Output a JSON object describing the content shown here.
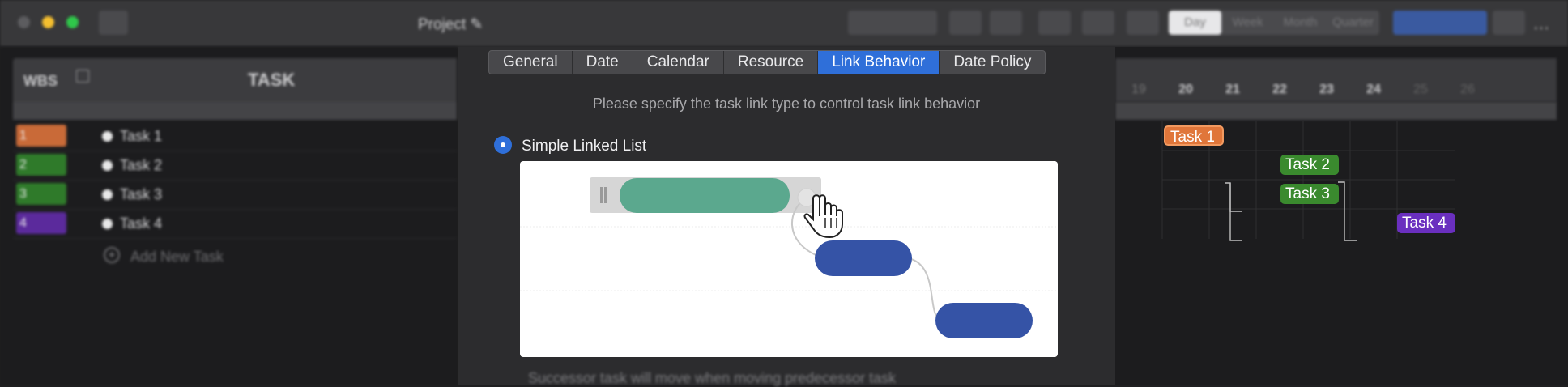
{
  "window": {
    "title": "Project"
  },
  "toolbar": {
    "view_segments": [
      "Day",
      "Week",
      "Month",
      "Quarter"
    ],
    "selected_view": "Day"
  },
  "grid": {
    "headers": {
      "wbs": "WBS",
      "task": "TASK"
    },
    "rows": [
      {
        "wbs": "1",
        "name": "Task 1",
        "color": "#c96a38"
      },
      {
        "wbs": "2",
        "name": "Task 2",
        "color": "#2f7a2a"
      },
      {
        "wbs": "3",
        "name": "Task 3",
        "color": "#2f7a2a"
      },
      {
        "wbs": "4",
        "name": "Task 4",
        "color": "#5b2a9c"
      }
    ],
    "add_task": "Add New Task"
  },
  "timeline": {
    "dates": [
      "19",
      "20",
      "21",
      "22",
      "23",
      "24",
      "25",
      "26"
    ],
    "bars": [
      {
        "label": "Task 1",
        "color": "#e0763a"
      },
      {
        "label": "Task 2",
        "color": "#3a8a2e"
      },
      {
        "label": "Task 3",
        "color": "#3a8a2e"
      },
      {
        "label": "Task 4",
        "color": "#6a2fbf"
      }
    ]
  },
  "dialog": {
    "tabs": [
      "General",
      "Date",
      "Calendar",
      "Resource",
      "Link Behavior",
      "Date Policy"
    ],
    "active_tab": "Link Behavior",
    "instruction": "Please specify the task link type to control task link behavior",
    "option": {
      "label": "Simple Linked List",
      "selected": true
    },
    "description": "Successor task will move when moving predecessor task"
  },
  "colors": {
    "accent": "#2f6fd9",
    "preview_green": "#5ba88e",
    "preview_blue": "#3553a6"
  }
}
